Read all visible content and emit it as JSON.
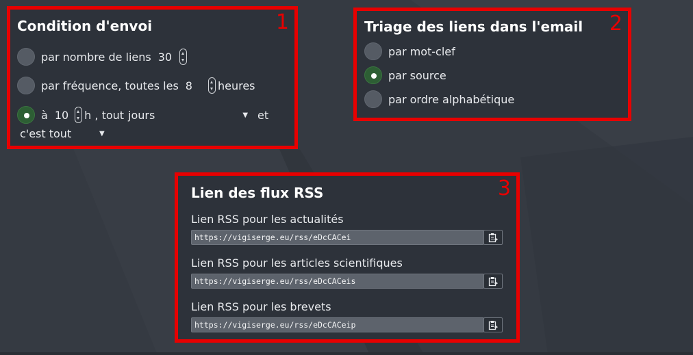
{
  "panel_send": {
    "number": "1",
    "title": "Condition d'envoi",
    "option_links": {
      "label": "par nombre de liens",
      "value": "30"
    },
    "option_frequency": {
      "label": "par fréquence, toutes les",
      "value": "8",
      "unit": "heures"
    },
    "option_time": {
      "prefix": "à",
      "hour": "10",
      "suffix": "h , tout",
      "days": "jours",
      "and": "et",
      "extra": "c'est tout"
    }
  },
  "panel_sort": {
    "number": "2",
    "title": "Triage des liens dans l'email",
    "options": [
      "par mot-clef",
      "par source",
      "par ordre alphabétique"
    ]
  },
  "panel_rss": {
    "number": "3",
    "title": "Lien des flux RSS",
    "feeds": [
      {
        "label": "Lien RSS pour les actualités",
        "url": "https://vigiserge.eu/rss/eDcCACei"
      },
      {
        "label": "Lien RSS pour les articles scientifiques",
        "url": "https://vigiserge.eu/rss/eDcCACeis"
      },
      {
        "label": "Lien RSS pour les brevets",
        "url": "https://vigiserge.eu/rss/eDcCACeip"
      }
    ]
  },
  "colors": {
    "highlight": "#e80000",
    "radio_selected": "#2d5e34",
    "background": "#353a42"
  }
}
